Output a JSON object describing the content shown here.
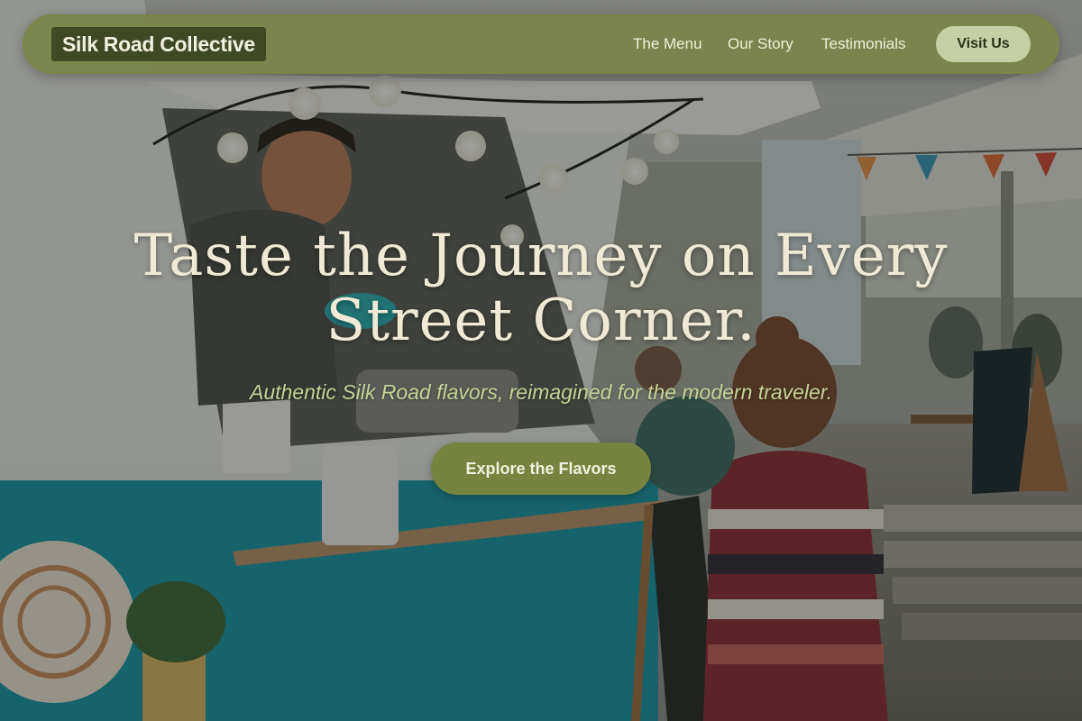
{
  "nav": {
    "brand": "Silk Road Collective",
    "links": [
      {
        "label": "The Menu"
      },
      {
        "label": "Our Story"
      },
      {
        "label": "Testimonials"
      }
    ],
    "cta_label": "Visit Us"
  },
  "hero": {
    "title_line1": "Taste the Journey on Every",
    "title_line2": "Street Corner.",
    "subtitle": "Authentic Silk Road flavors, reimagined for the modern traveler.",
    "cta_label": "Explore the Flavors"
  },
  "colors": {
    "nav_background": "#7a8448",
    "brand_chip": "#3f4a25",
    "nav_cta": "#c6d0a7",
    "title_text": "#efe9d6",
    "subtitle_text": "#c3d394",
    "hero_cta": "#77843f"
  },
  "background": {
    "icons": [
      "food-truck-photo",
      "string-lights",
      "bunting-flags",
      "menu-chalkboard"
    ]
  }
}
